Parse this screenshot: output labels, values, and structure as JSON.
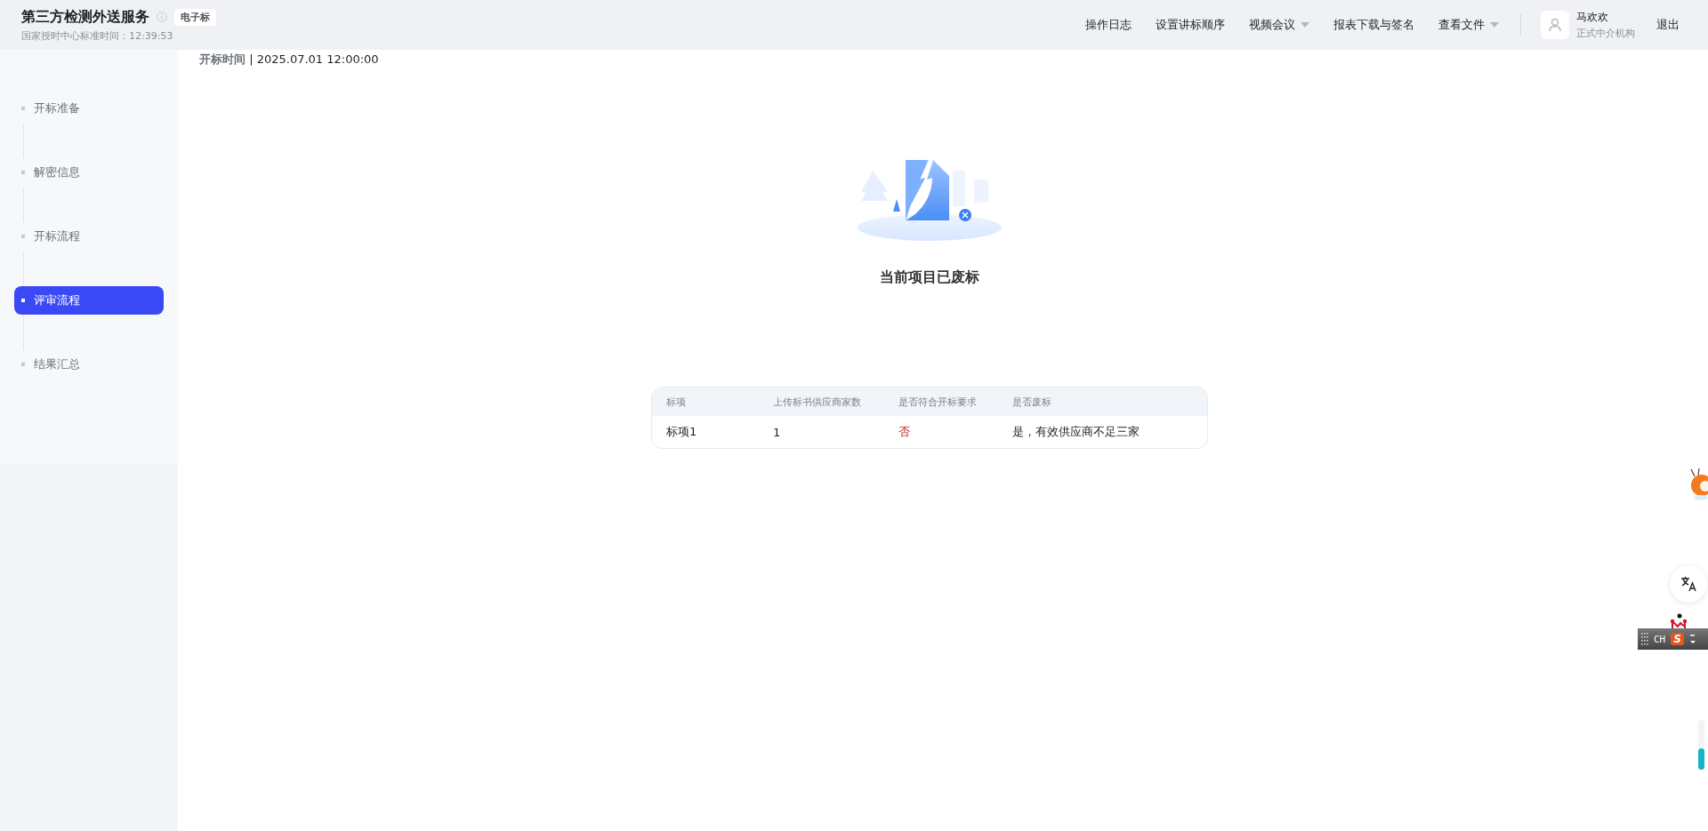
{
  "header": {
    "title": "第三方检测外送服务",
    "tag": "电子标",
    "clock_label": "国家授时中心标准时间：12:39:53",
    "nav": [
      {
        "label": "操作日志",
        "dropdown": false
      },
      {
        "label": "设置讲标顺序",
        "dropdown": false
      },
      {
        "label": "视频会议",
        "dropdown": true
      },
      {
        "label": "报表下载与签名",
        "dropdown": false
      },
      {
        "label": "查看文件",
        "dropdown": true
      }
    ],
    "user": {
      "name": "马欢欢",
      "role": "正式中介机构"
    },
    "logout": "退出"
  },
  "sidebar": {
    "items": [
      {
        "label": "开标准备",
        "selected": false
      },
      {
        "label": "解密信息",
        "selected": false
      },
      {
        "label": "开标流程",
        "selected": false
      },
      {
        "label": "评审流程",
        "selected": true
      },
      {
        "label": "结果汇总",
        "selected": false
      }
    ]
  },
  "main": {
    "open_time_label": "开标时间",
    "open_time_separator": "|",
    "open_time": "2025.07.01 12:00:00",
    "status_message": "当前项目已废标",
    "table": {
      "columns": [
        "标项",
        "上传标书供应商家数",
        "是否符合开标要求",
        "是否废标"
      ],
      "rows": [
        [
          {
            "text": "标项1",
            "kind": "plain"
          },
          {
            "text": "1",
            "kind": "plain"
          },
          {
            "text": "否",
            "kind": "negative"
          },
          {
            "text": "是，有效供应商不足三家",
            "kind": "plain"
          }
        ]
      ]
    }
  },
  "ime_bar": {
    "language": "CH",
    "logo": "S"
  }
}
